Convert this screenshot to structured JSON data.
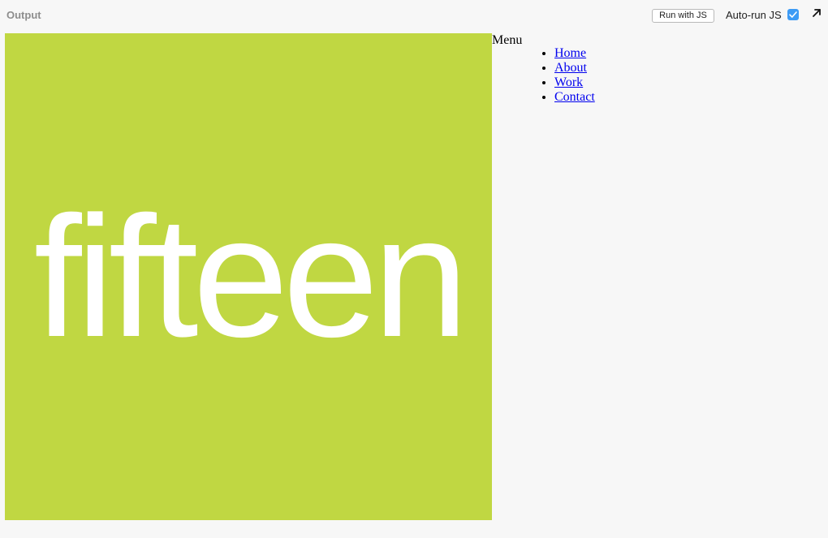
{
  "toolbar": {
    "panel_title": "Output",
    "run_button_label": "Run with JS",
    "autorun_label": "Auto-run JS",
    "autorun_checked": true,
    "popout_icon": "arrow-up-right-icon"
  },
  "logo": {
    "text": "fifteen",
    "background_color": "#c0d742",
    "text_color": "#ffffff"
  },
  "menu": {
    "label": "Menu",
    "items": [
      {
        "label": "Home"
      },
      {
        "label": "About"
      },
      {
        "label": "Work"
      },
      {
        "label": "Contact"
      }
    ]
  },
  "colors": {
    "page_background": "#f7f7f7",
    "link": "#0000ee",
    "checkbox_accent": "#3d9bf5"
  }
}
